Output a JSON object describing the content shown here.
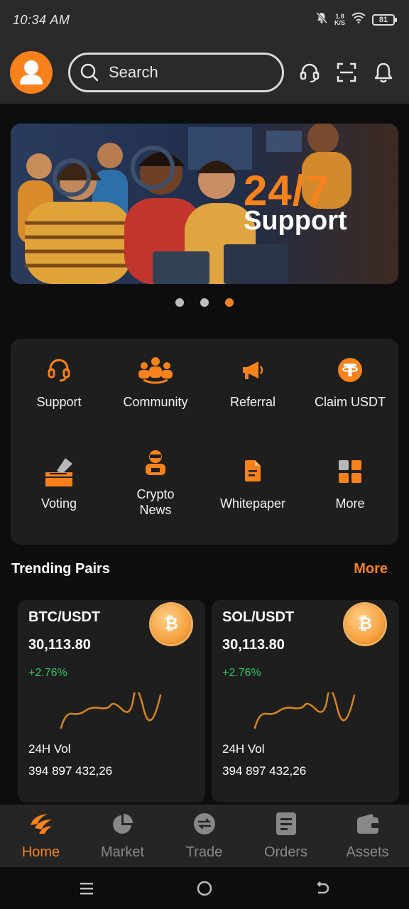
{
  "status": {
    "time": "10:34 AM",
    "speed_value": "1.8",
    "speed_unit": "K/S",
    "battery": "81"
  },
  "header": {
    "search_placeholder": "Search"
  },
  "banner": {
    "headline": "24/7",
    "subline": "Support",
    "dots": 3,
    "active_dot": 3
  },
  "quick_actions": [
    {
      "label": "Support",
      "icon": "headset-icon"
    },
    {
      "label": "Community",
      "icon": "community-icon"
    },
    {
      "label": "Referral",
      "icon": "megaphone-icon"
    },
    {
      "label": "Claim USDT",
      "icon": "tether-icon"
    },
    {
      "label": "Voting",
      "icon": "ballot-box-icon"
    },
    {
      "label": "Crypto\nNews",
      "icon": "news-anchor-icon"
    },
    {
      "label": "Whitepaper",
      "icon": "document-icon"
    },
    {
      "label": "More",
      "icon": "grid-icon"
    }
  ],
  "trending": {
    "title": "Trending Pairs",
    "more_label": "More",
    "cards": [
      {
        "pair": "BTC/USDT",
        "price": "30,113.80",
        "change": "+2.76%",
        "vol_label": "24H Vol",
        "vol_value": "394 897 432,26",
        "coin": "bitcoin-icon"
      },
      {
        "pair": "SOL/USDT",
        "price": "30,113.80",
        "change": "+2.76%",
        "vol_label": "24H Vol",
        "vol_value": "394 897 432,26",
        "coin": "bitcoin-icon"
      }
    ]
  },
  "tabs": [
    {
      "label": "Home",
      "icon": "home-icon",
      "active": true
    },
    {
      "label": "Market",
      "icon": "pie-chart-icon",
      "active": false
    },
    {
      "label": "Trade",
      "icon": "swap-icon",
      "active": false
    },
    {
      "label": "Orders",
      "icon": "orders-icon",
      "active": false
    },
    {
      "label": "Assets",
      "icon": "wallet-icon",
      "active": false
    }
  ],
  "colors": {
    "accent": "#f7821b",
    "positive": "#2ec866",
    "background": "#0d0d0d",
    "surface": "#1e1e1e"
  }
}
